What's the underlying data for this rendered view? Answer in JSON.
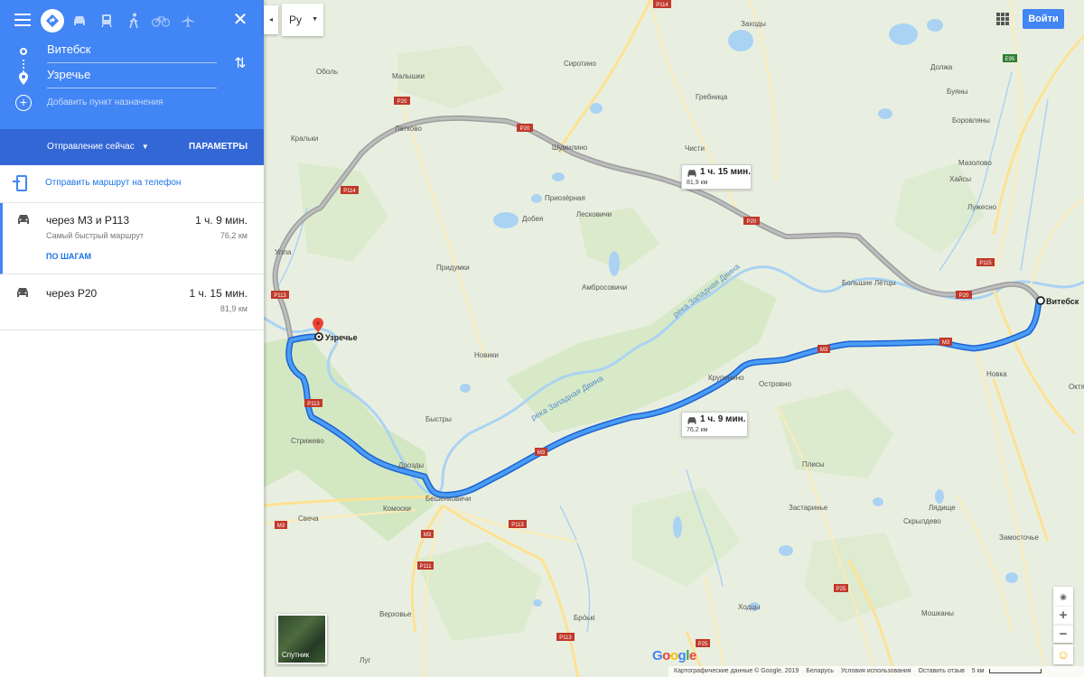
{
  "panel": {
    "travel_modes": [
      "best-mode",
      "drive",
      "transit",
      "walk",
      "bike",
      "flight"
    ],
    "origin": "Витебск",
    "destination": "Узречье",
    "add_destination": "Добавить пункт назначения",
    "depart": "Отправление сейчас",
    "options": "ПАРАМЕТРЫ",
    "send_to_phone": "Отправить маршрут на телефон",
    "routes": [
      {
        "via": "через М3 и Р113",
        "time": "1 ч. 9 мин.",
        "subtitle": "Самый быстрый маршрут",
        "distance": "76,2 км",
        "details": "ПО ШАГАМ",
        "selected": true
      },
      {
        "via": "через Р20",
        "time": "1 ч. 15 мин.",
        "distance": "81,9 км",
        "selected": false
      }
    ]
  },
  "topbar": {
    "collapse_glyph": "◂",
    "language": "Ру",
    "sign_in": "Войти"
  },
  "map": {
    "colors": {
      "route_primary": "#4285f4",
      "route_alt": "#a9a9a9",
      "water": "#aad3f3",
      "forest": "#cfe6be",
      "land": "#e9efe0",
      "road": "#fcebb6"
    },
    "callouts": [
      {
        "time": "1 ч. 15 мин.",
        "distance": "81,9 км"
      },
      {
        "time": "1 ч. 9 мин.",
        "distance": "76,2 км"
      }
    ],
    "endpoint_labels": {
      "start": "Витебск",
      "end": "Узречье"
    },
    "places": [
      "Заходы",
      "Сиротино",
      "Малышки",
      "Оболь",
      "Должа",
      "Гребница",
      "Буяны",
      "Латково",
      "Кральки",
      "Шумилино",
      "Боровляны",
      "Чисти",
      "Мазолово",
      "Хайсы",
      "Приозёрная",
      "Добея",
      "Лесковичи",
      "Лужесно",
      "Улла",
      "Придумки",
      "Амбросовичи",
      "Большие Лётцы",
      "Новики",
      "Крупенино",
      "Островно",
      "Новка",
      "Октя",
      "Быстры",
      "Стрижево",
      "Дрозды",
      "Бешенковичи",
      "Плисы",
      "Свеча",
      "Комоски",
      "Застаринье",
      "Лядище",
      "Скрылдево",
      "Замосточье",
      "Ходцы",
      "Бро́ькі",
      "Верховье",
      "Мошканы",
      "Луг"
    ],
    "road_labels": [
      "P114",
      "P20",
      "P20",
      "P20",
      "P20",
      "P114",
      "P113",
      "P113",
      "M3",
      "M3",
      "M3",
      "M3",
      "P113",
      "P111",
      "P113",
      "P25",
      "P25",
      "P115",
      "E95"
    ],
    "rivers": [
      "река Западная Двина",
      "река Западная Двина"
    ],
    "logo_letters": [
      "G",
      "o",
      "o",
      "g",
      "l",
      "e"
    ],
    "logo_colors": [
      "#4285f4",
      "#ea4335",
      "#fbbc05",
      "#4285f4",
      "#34a853",
      "#ea4335"
    ],
    "satellite_label": "Спутник",
    "zoom_in": "+",
    "zoom_out": "−",
    "locate_glyph": "◉",
    "pegman_glyph": "☺",
    "footer": {
      "data": "Картографические данные © Google, 2019",
      "country": "Беларусь",
      "terms": "Условия использования",
      "feedback": "Оставить отзыв",
      "scale": "5 км"
    }
  }
}
